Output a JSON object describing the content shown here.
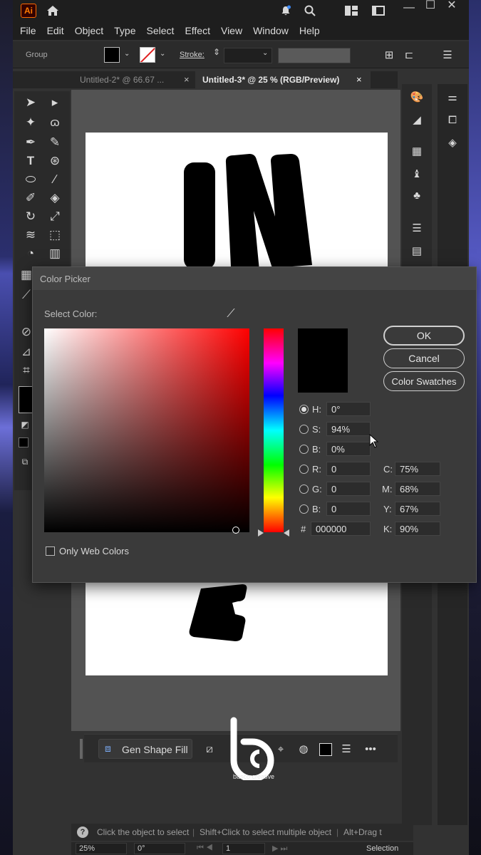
{
  "menu": [
    "File",
    "Edit",
    "Object",
    "Type",
    "Select",
    "Effect",
    "View",
    "Window",
    "Help"
  ],
  "app_logo": "Ai",
  "control_bar": {
    "selection_label": "Group",
    "stroke_label": "Stroke:"
  },
  "tabs": [
    {
      "label": "Untitled-2* @ 66.67 ...",
      "active": false
    },
    {
      "label": "Untitled-3* @ 25 % (RGB/Preview)",
      "active": true
    }
  ],
  "dialog": {
    "title": "Color Picker",
    "select_color_label": "Select Color:",
    "fields": {
      "H": "0°",
      "S": "94%",
      "B": "0%",
      "R": "0",
      "G": "0",
      "B2": "0",
      "hex": "000000",
      "C": "75%",
      "M": "68%",
      "Y": "67%",
      "K": "90%"
    },
    "field_labels": {
      "H": "H:",
      "S": "S:",
      "B": "B:",
      "R": "R:",
      "G": "G:",
      "B2": "B:",
      "hex": "#",
      "C": "C:",
      "M": "M:",
      "Y": "Y:",
      "K": "K:"
    },
    "buttons": {
      "ok": "OK",
      "cancel": "Cancel",
      "swatches": "Color Swatches"
    },
    "only_web_colors": "Only Web Colors",
    "current_color": "#000000",
    "selected_mode": "H"
  },
  "contextual_bar": {
    "gen_shape_fill": "Gen Shape Fill"
  },
  "status": {
    "hint1": "Click the object to select",
    "hint2": "Shift+Click to select multiple object",
    "hint3": "Alt+Drag t",
    "zoom": "25%",
    "rotation": "0°",
    "artboard": "1",
    "mode": "Selection"
  },
  "watermark": "basco creative"
}
